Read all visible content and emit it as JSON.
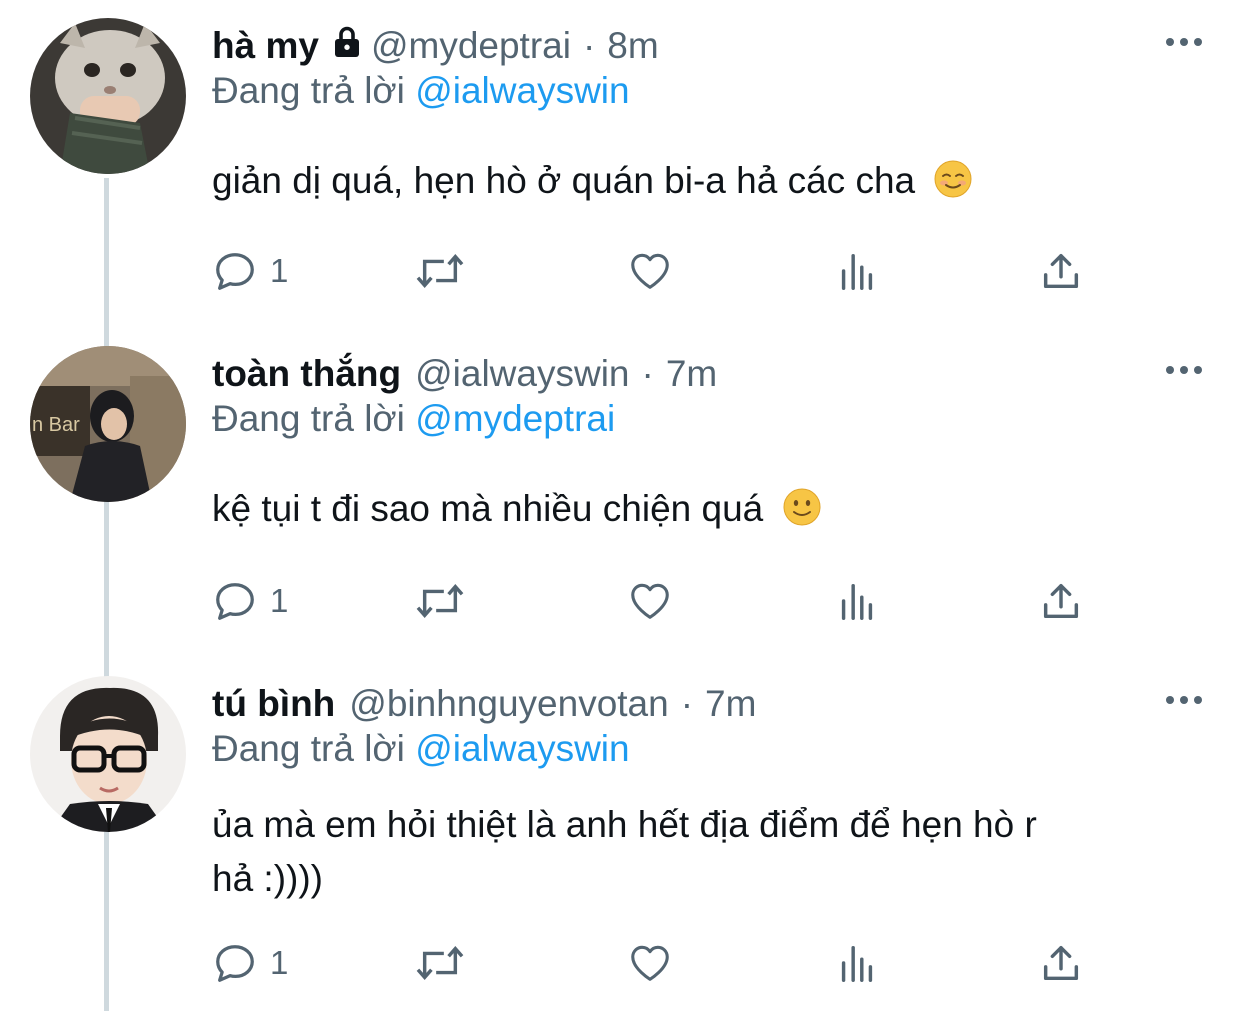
{
  "tweets": [
    {
      "name": "hà my",
      "locked": true,
      "handle": "@mydeptrai",
      "separator": "·",
      "time": "8m",
      "replying_prefix": "Đang trả lời",
      "replying_to": "@ialwayswin",
      "text": "giản dị quá, hẹn hò ở quán bi-a hả các cha",
      "emoji": "smiling-face-icon",
      "reply_count": "1"
    },
    {
      "name": "toàn thắng",
      "locked": false,
      "handle": "@ialwayswin",
      "separator": "·",
      "time": "7m",
      "replying_prefix": "Đang trả lời",
      "replying_to": "@mydeptrai",
      "text": "kệ tụi t đi sao mà nhiều chiện quá",
      "emoji": "slight-smile-icon",
      "reply_count": "1"
    },
    {
      "name": "tú bình",
      "locked": false,
      "handle": "@binhnguyenvotan",
      "separator": "·",
      "time": "7m",
      "replying_prefix": "Đang trả lời",
      "replying_to": "@ialwayswin",
      "text_line1": "ủa mà em hỏi thiệt là anh hết địa điểm để hẹn hò r",
      "text_line2": "hả :))))",
      "reply_count": "1"
    }
  ],
  "colors": {
    "primary_text": "#0f1419",
    "secondary_text": "#536471",
    "link": "#1d9bf0",
    "thread_line": "#cfd9de"
  }
}
